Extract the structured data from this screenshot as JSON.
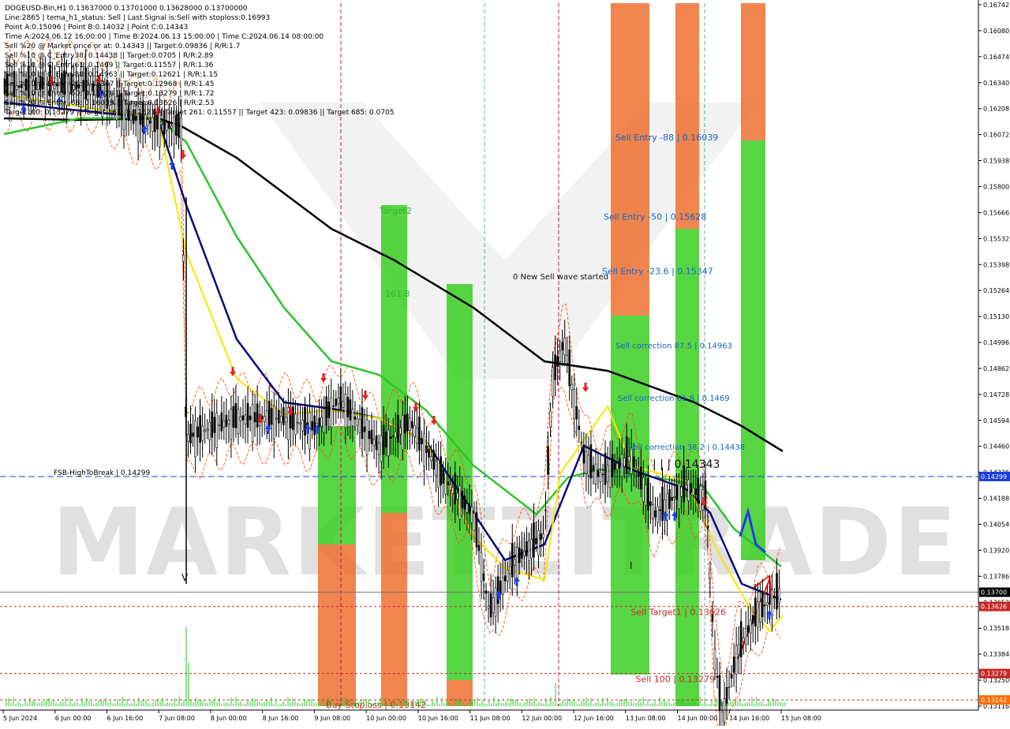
{
  "chart_data": {
    "type": "candlestick",
    "symbol_line": "DOGEUSD-Bin,H1  0.13637000 0.13701000 0.13628000 0.13700000",
    "info_lines": [
      "Line:2865 | tema_h1_status: Sell | Last Signal is:Sell with stoploss:0.16993",
      "Point A:0.15096 | Point B:0.14032 | Point C:0.14343",
      "Time A:2024.06.12 16:00:00 | Time B:2024.06.13 15:00:00 | Time C:2024.06.14 08:00:00",
      "Sell %20 @ Market price or at: 0.14343 || Target:0.09836 | R/R:1.7",
      "Sell %10 @ C_Entry38: 0.14438 || Target:0.0705 | R/R:2.89",
      "Sell %10 @ C_Entry61: 0.1469 || Target:0.11557 | R/R:1.36",
      "Sell %10 @ C_Entry88: 0.14963 || Target:0.12621 | R/R:1.15",
      "Sell %10 @ Entry -23: 0.15347 || Target:0.12968 | R/R:1.45",
      "Sell %10 @ Entry -50: 0.15628 || Target:0.13279 | R/R:1.72",
      "Sell %20 @ Entry -88: 0.16039 || Target:0.13626 | R/R:2.53",
      "Target100: 0.13279 || Target 161: 0.12621 || Target 261: 0.11557 || Target 423: 0.09836 || Target 685: 0.0705"
    ],
    "y_axis": {
      "min": 0.1311,
      "max": 0.1675,
      "ticks": [
        "0.16742",
        "0.16080",
        "0.16474",
        "0.16340",
        "0.16208",
        "0.16072",
        "0.15938",
        "0.15800",
        "0.15666",
        "0.15532",
        "0.15398",
        "0.15264",
        "0.15130",
        "0.14996",
        "0.14862",
        "0.14728",
        "0.14594",
        "0.14460",
        "0.14326",
        "0.14188",
        "0.14054",
        "0.13920",
        "0.13786",
        "0.13652",
        "0.13518",
        "0.13384",
        "0.13250",
        "0.13116"
      ]
    },
    "x_axis": {
      "ticks": [
        "5 Jun 2024",
        "6 Jun 00:00",
        "6 Jun 16:00",
        "7 Jun 08:00",
        "8 Jun 00:00",
        "8 Jun 16:00",
        "9 Jun 08:00",
        "10 Jun 00:00",
        "10 Jun 16:00",
        "11 Jun 08:00",
        "12 Jun 00:00",
        "12 Jun 16:00",
        "13 Jun 08:00",
        "14 Jun 00:00",
        "14 Jun 16:00",
        "15 Jun 08:00"
      ]
    },
    "price_tags": [
      {
        "label": "0.14299",
        "value": 0.14299,
        "bg": "#1c3cdc"
      },
      {
        "label": "0.13700",
        "value": 0.137,
        "bg": "#000000"
      },
      {
        "label": "0.13626",
        "value": 0.13626,
        "bg": "#c62828"
      },
      {
        "label": "0.13279",
        "value": 0.13279,
        "bg": "#c62828"
      },
      {
        "label": "0.13142",
        "value": 0.13142,
        "bg": "#ff6d00"
      }
    ],
    "levels": [
      {
        "label": "FSB-HighToBreak | 0.14299",
        "value": 0.14299,
        "color": "#1c3cdc",
        "style": "dashed"
      },
      {
        "label": "Sell Target1 | 0.13626",
        "value": 0.13626,
        "color": "#c62828",
        "style": "dotted"
      },
      {
        "label": "Sell 100 | 0.13279",
        "value": 0.13279,
        "color": "#c62828",
        "style": "dotted"
      },
      {
        "label": "Buy Stoploss | 0.13142",
        "value": 0.13142,
        "color": "#c62828",
        "style": "dotted"
      },
      {
        "label": "",
        "value": 0.137,
        "color": "#777777",
        "style": "solid"
      }
    ],
    "annotations": [
      {
        "text": "Sell Entry -88 | 0.16039",
        "value": 0.16039,
        "color": "#1565c0"
      },
      {
        "text": "Sell Entry -50 | 0.15628",
        "value": 0.15628,
        "color": "#1565c0"
      },
      {
        "text": "Sell Entry -23.6 | 0.15347",
        "value": 0.15347,
        "color": "#1565c0"
      },
      {
        "text": "Sell correction 87.5 | 0.14963",
        "value": 0.14963,
        "color": "#1565c0"
      },
      {
        "text": "Sell correction 61.8 | 0.1469",
        "value": 0.1469,
        "color": "#1565c0"
      },
      {
        "text": "| | | 0.14343",
        "value": 0.14343,
        "color": "#111111"
      },
      {
        "text": "Sell correction 38.2 | 0.14438",
        "value": 0.14438,
        "color": "#1565c0"
      },
      {
        "text": "0 New Sell wave started",
        "value": 0.1532,
        "color": "#111111"
      },
      {
        "text": "Target2",
        "value": 0.1566,
        "color": "#2eb82e"
      },
      {
        "text": "161.8",
        "value": 0.1523,
        "color": "#2eb82e"
      },
      {
        "text": "V",
        "value": 0.1376,
        "color": "#111111"
      },
      {
        "text": "I",
        "value": 0.1382,
        "color": "#111111"
      }
    ],
    "watermark": "MARKETZITRADE",
    "colors": {
      "bull_candle": "#000000",
      "bear_candle": "#000000",
      "green_zone": "#33cc1a",
      "orange_zone": "#ee6a2a",
      "ma_black": "#000000",
      "ma_green": "#2ec42e",
      "ma_navy": "#0a0a7a",
      "ma_yellow": "#f4e800",
      "envelope": "#ff4400",
      "volume": "#22cc22",
      "buy_arrow": "#1e40e8",
      "sell_arrow": "#e81e1e"
    }
  }
}
